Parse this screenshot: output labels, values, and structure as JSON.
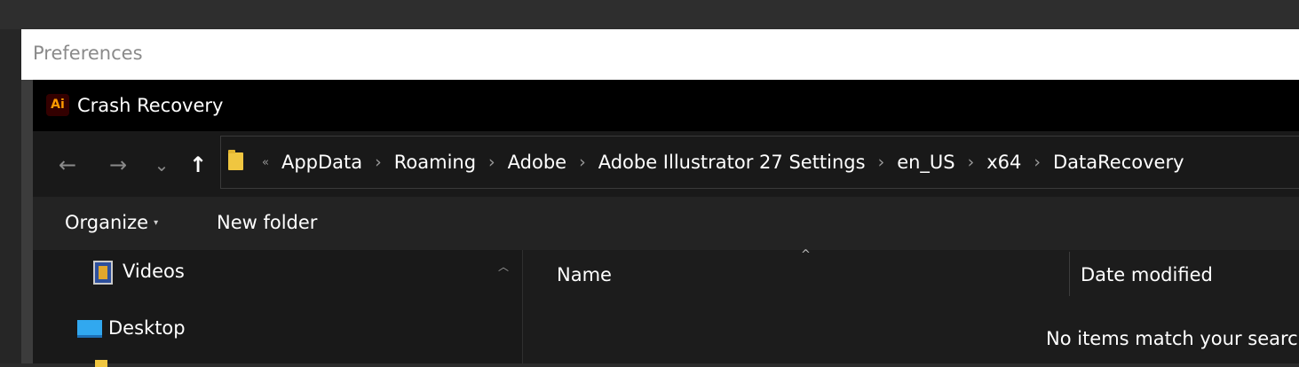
{
  "preferences": {
    "title": "Preferences"
  },
  "dialog": {
    "app_icon_text": "Ai",
    "title": "Crash Recovery",
    "nav": {
      "back_glyph": "←",
      "forward_glyph": "→",
      "recent_glyph": "⌄",
      "up_glyph": "↑"
    },
    "address": {
      "overflow_glyph": "«",
      "separator": "›",
      "crumbs": [
        "AppData",
        "Roaming",
        "Adobe",
        "Adobe Illustrator 27 Settings",
        "en_US",
        "x64",
        "DataRecovery"
      ]
    },
    "toolbar": {
      "organize": "Organize",
      "organize_caret": "▾",
      "new_folder": "New folder"
    },
    "nav_pane": {
      "items": [
        "Videos",
        "Desktop"
      ]
    },
    "columns": {
      "name": "Name",
      "date_modified": "Date modified",
      "sort_glyph": "^"
    },
    "empty_message": "No items match your search."
  },
  "colors": {
    "accent_logo": "#ff9a00",
    "logo_bg": "#330000",
    "folder": "#f0c640"
  }
}
